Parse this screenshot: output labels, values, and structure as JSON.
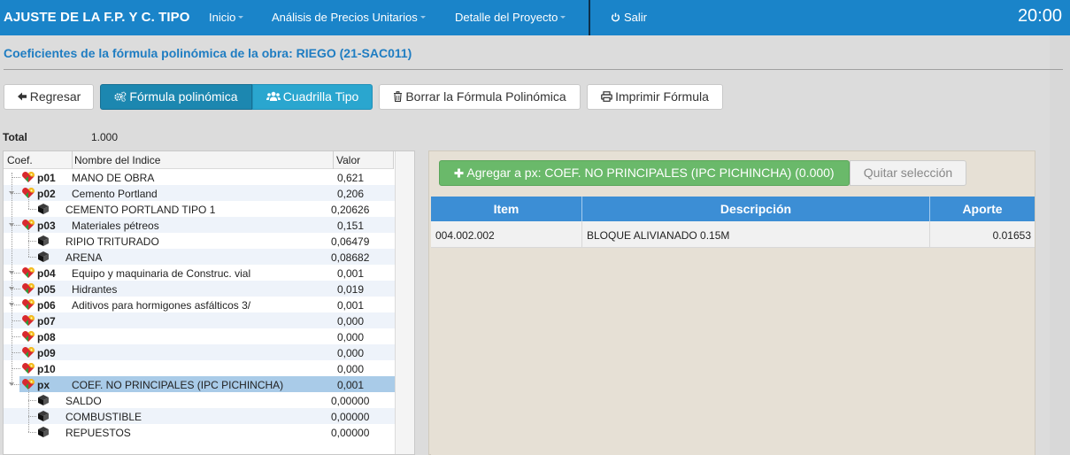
{
  "navbar": {
    "brand": "AJUSTE DE LA F.P. Y C. TIPO",
    "items": [
      {
        "label": "Inicio"
      },
      {
        "label": "Análisis de Precios Unitarios"
      },
      {
        "label": "Detalle del Proyecto"
      }
    ],
    "logout_label": "Salir",
    "clock": "20:00"
  },
  "page": {
    "title": "Coeficientes de la fórmula polinómica de la obra: RIEGO (21-SAC011)"
  },
  "toolbar": {
    "back_label": "Regresar",
    "formula_label": "Fórmula polinómica",
    "crew_label": "Cuadrilla Tipo",
    "delete_label": "Borrar la Fórmula Polinómica",
    "print_label": "Imprimir Fórmula"
  },
  "total": {
    "label": "Total",
    "value": "1.000"
  },
  "tree": {
    "columns": {
      "coef": "Coef.",
      "name": "Nombre del Indice",
      "value": "Valor"
    },
    "rows": [
      {
        "type": "coef",
        "coef": "p01",
        "name": "MANO DE OBRA",
        "value": "0,621"
      },
      {
        "type": "coef",
        "coef": "p02",
        "name": "Cemento Portland",
        "value": "0,206"
      },
      {
        "type": "item",
        "name": "CEMENTO PORTLAND TIPO 1",
        "value": "0,20626"
      },
      {
        "type": "coef",
        "coef": "p03",
        "name": "Materiales pétreos",
        "value": "0,151"
      },
      {
        "type": "item",
        "name": "RIPIO TRITURADO",
        "value": "0,06479"
      },
      {
        "type": "item",
        "name": "ARENA",
        "value": "0,08682"
      },
      {
        "type": "coef",
        "coef": "p04",
        "name": "Equipo y maquinaria de Construc. vial",
        "value": "0,001"
      },
      {
        "type": "coef",
        "coef": "p05",
        "name": "Hidrantes",
        "value": "0,019"
      },
      {
        "type": "coef",
        "coef": "p06",
        "name": "Aditivos para hormigones asfálticos 3/",
        "value": "0,001"
      },
      {
        "type": "coef",
        "coef": "p07",
        "name": "",
        "value": "0,000"
      },
      {
        "type": "coef",
        "coef": "p08",
        "name": "",
        "value": "0,000"
      },
      {
        "type": "coef",
        "coef": "p09",
        "name": "",
        "value": "0,000"
      },
      {
        "type": "coef",
        "coef": "p10",
        "name": "",
        "value": "0,000"
      },
      {
        "type": "coef",
        "coef": "px",
        "name": "COEF. NO PRINCIPALES (IPC PICHINCHA)",
        "value": "0,001",
        "selected": true
      },
      {
        "type": "item",
        "name": "SALDO",
        "value": "0,00000"
      },
      {
        "type": "item",
        "name": "COMBUSTIBLE",
        "value": "0,00000"
      },
      {
        "type": "item",
        "name": "REPUESTOS",
        "value": "0,00000"
      }
    ]
  },
  "right": {
    "add_label": "Agregar a px: COEF. NO PRINCIPALES (IPC PICHINCHA) (0.000)",
    "clear_label": "Quitar selección",
    "columns": {
      "item": "Item",
      "desc": "Descripción",
      "aporte": "Aporte"
    },
    "rows": [
      {
        "item": "004.002.002",
        "desc": "BLOQUE ALIVIANADO 0.15M",
        "aporte": "0.01653"
      }
    ]
  },
  "colors": {
    "navbar": "#1a84c9",
    "title": "#1f7dc2",
    "primary": "#2aa6cf",
    "success": "#6ab96a",
    "grid_header": "#3c8ed5",
    "selected_row": "#a9cbe8"
  }
}
